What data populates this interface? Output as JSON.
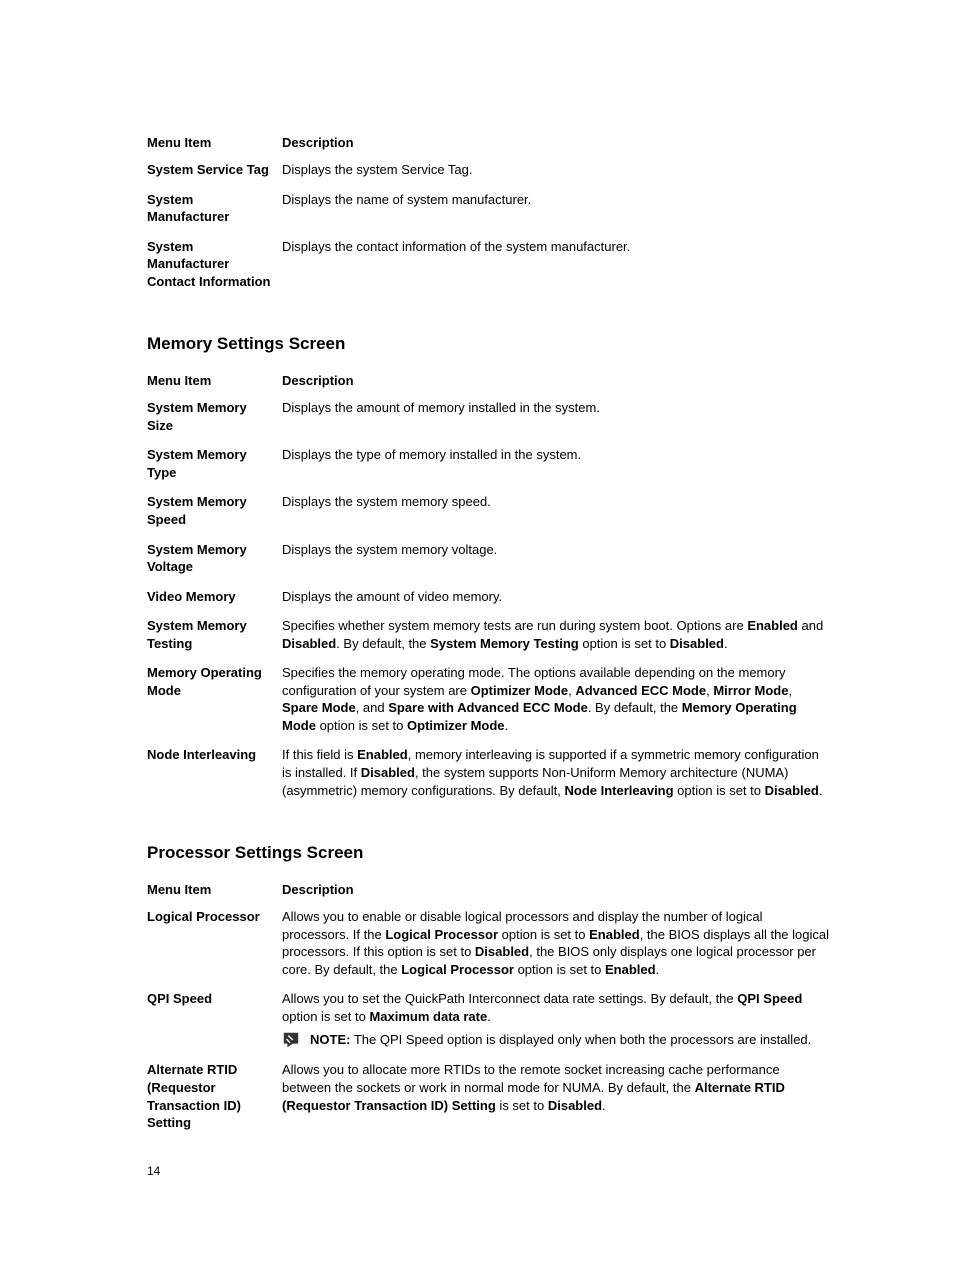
{
  "headers": {
    "menu": "Menu Item",
    "desc": "Description"
  },
  "table1": [
    {
      "menu": "System Service Tag",
      "desc": "Displays the system Service Tag."
    },
    {
      "menu": "System Manufacturer",
      "desc": "Displays the name of system manufacturer."
    },
    {
      "menu": "System Manufacturer Contact Information",
      "desc": "Displays the contact information of the system manufacturer."
    }
  ],
  "section2_title": "Memory Settings Screen",
  "table2": [
    {
      "menu": "System Memory Size",
      "desc_html": "Displays the amount of memory installed in the system."
    },
    {
      "menu": "System Memory Type",
      "desc_html": "Displays the type of memory installed in the system."
    },
    {
      "menu": "System Memory Speed",
      "desc_html": "Displays the system memory speed."
    },
    {
      "menu": "System Memory Voltage",
      "desc_html": "Displays the system memory voltage."
    },
    {
      "menu": "Video Memory",
      "desc_html": "Displays the amount of video memory."
    },
    {
      "menu": "System Memory Testing",
      "desc_html": "Specifies whether system memory tests are run during system boot. Options are <strong>Enabled</strong> and <strong>Disabled</strong>. By default, the <strong>System Memory Testing</strong> option is set to <strong>Disabled</strong>."
    },
    {
      "menu": "Memory Operating Mode",
      "desc_html": "Specifies the memory operating mode. The options available depending on the memory configuration of your system are <strong>Optimizer Mode</strong>, <strong>Advanced ECC Mode</strong>, <strong>Mirror Mode</strong>, <strong>Spare Mode</strong>, and <strong>Spare with Advanced ECC Mode</strong>. By default, the <strong>Memory Operating Mode</strong> option is set to <strong>Optimizer Mode</strong>."
    },
    {
      "menu": "Node Interleaving",
      "desc_html": "If this field is <strong>Enabled</strong>, memory interleaving is supported if a symmetric memory configuration is installed. If <strong>Disabled</strong>, the system supports Non-Uniform Memory architecture (NUMA) (asymmetric) memory configurations. By default, <strong>Node Interleaving</strong> option is set to <strong>Disabled</strong>."
    }
  ],
  "section3_title": "Processor Settings Screen",
  "table3": [
    {
      "menu": "Logical Processor",
      "desc_html": "Allows you to enable or disable logical processors and display the number of logical processors. If the <strong>Logical Processor</strong> option is set to <strong>Enabled</strong>, the BIOS displays all the logical processors. If this option is set to <strong>Disabled</strong>, the BIOS only displays one logical processor per core. By default, the <strong>Logical Processor</strong> option is set to <strong>Enabled</strong>."
    },
    {
      "menu": "QPI Speed",
      "desc_html": "Allows you to set the QuickPath Interconnect data rate settings. By default, the <strong>QPI Speed</strong> option is set to <strong>Maximum data rate</strong>.",
      "note_html": "<strong>NOTE:</strong> The QPI Speed option is displayed only when both the processors are installed."
    },
    {
      "menu": "Alternate RTID (Requestor Transaction ID) Setting",
      "desc_html": "Allows you to allocate more RTIDs to the remote socket increasing cache performance between the sockets or work in normal mode for NUMA. By default, the <strong>Alternate RTID (Requestor Transaction ID) Setting</strong> is set to <strong>Disabled</strong>."
    }
  ],
  "page_number": "14"
}
